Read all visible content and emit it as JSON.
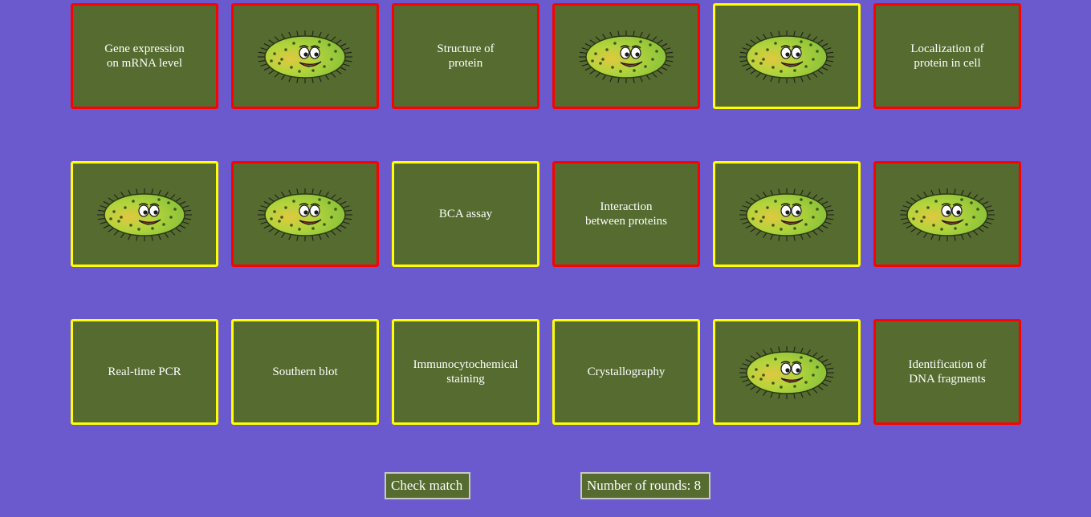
{
  "colors": {
    "background": "#6a5acd",
    "card_fill": "#556b2f",
    "border_red": "#ff0000",
    "border_yellow": "#ffff00"
  },
  "cards": [
    {
      "type": "text",
      "border": "red",
      "text": "Gene expression\non mRNA level"
    },
    {
      "type": "bacteria",
      "border": "red",
      "icon": "bacteria-icon"
    },
    {
      "type": "text",
      "border": "red",
      "text": "Structure of\nprotein"
    },
    {
      "type": "bacteria",
      "border": "red",
      "icon": "bacteria-icon"
    },
    {
      "type": "bacteria",
      "border": "yellow",
      "icon": "bacteria-icon"
    },
    {
      "type": "text",
      "border": "red",
      "text": "Localization of\nprotein in cell"
    },
    {
      "type": "bacteria",
      "border": "yellow",
      "icon": "bacteria-icon"
    },
    {
      "type": "bacteria",
      "border": "red",
      "icon": "bacteria-icon"
    },
    {
      "type": "text",
      "border": "yellow",
      "text": "BCA assay"
    },
    {
      "type": "text",
      "border": "red",
      "text": "Interaction\nbetween proteins"
    },
    {
      "type": "bacteria",
      "border": "yellow",
      "icon": "bacteria-icon"
    },
    {
      "type": "bacteria",
      "border": "red",
      "icon": "bacteria-icon"
    },
    {
      "type": "text",
      "border": "yellow",
      "text": "Real-time PCR"
    },
    {
      "type": "text",
      "border": "yellow",
      "text": "Southern blot"
    },
    {
      "type": "text",
      "border": "yellow",
      "text": "Immunocytochemical\nstaining"
    },
    {
      "type": "text",
      "border": "yellow",
      "text": "Crystallography"
    },
    {
      "type": "bacteria",
      "border": "yellow",
      "icon": "bacteria-icon"
    },
    {
      "type": "text",
      "border": "red",
      "text": "Identification of\nDNA fragments"
    }
  ],
  "controls": {
    "check_label": "Check match",
    "rounds_label": "Number of rounds: 8"
  }
}
